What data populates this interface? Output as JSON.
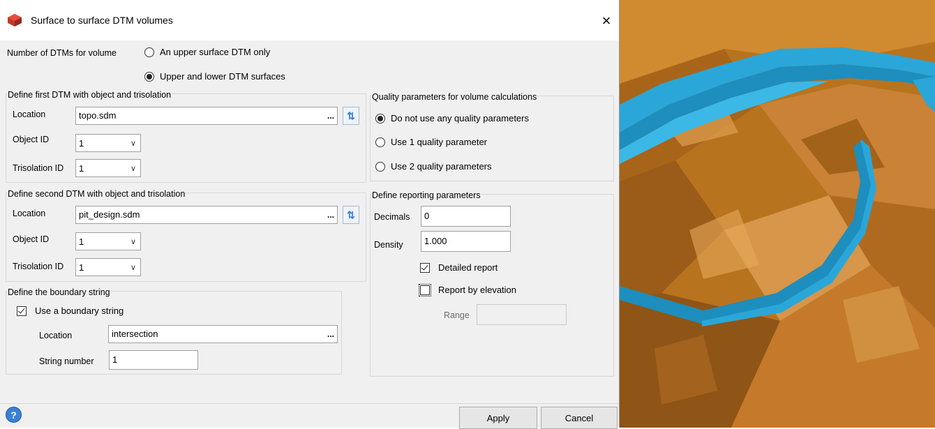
{
  "window": {
    "title": "Surface to surface DTM volumes",
    "close_icon": "×"
  },
  "dtm_count": {
    "label": "Number of DTMs for volume",
    "options": [
      {
        "label": "An upper surface DTM only",
        "selected": false
      },
      {
        "label": "Upper and lower DTM surfaces",
        "selected": true
      }
    ]
  },
  "first_dtm": {
    "legend": "Define first DTM with object and trisolation",
    "location_label": "Location",
    "location_value": "topo.sdm",
    "browse": "...",
    "object_label": "Object ID",
    "object_value": "1",
    "trisolation_label": "Trisolation ID",
    "trisolation_value": "1"
  },
  "second_dtm": {
    "legend": "Define second DTM with object and trisolation",
    "location_label": "Location",
    "location_value": "pit_design.sdm",
    "browse": "...",
    "object_label": "Object ID",
    "object_value": "1",
    "trisolation_label": "Trisolation ID",
    "trisolation_value": "1"
  },
  "boundary": {
    "legend": "Define the boundary string",
    "use_label": "Use a boundary string",
    "use_checked": true,
    "location_label": "Location",
    "location_value": "intersection",
    "browse": "...",
    "string_label": "String number",
    "string_value": "1"
  },
  "quality": {
    "legend": "Quality parameters for volume calculations",
    "options": [
      {
        "label": "Do not use any quality parameters",
        "selected": true
      },
      {
        "label": "Use 1 quality parameter",
        "selected": false
      },
      {
        "label": "Use 2 quality parameters",
        "selected": false
      }
    ]
  },
  "reporting": {
    "legend": "Define reporting parameters",
    "decimals_label": "Decimals",
    "decimals_value": "0",
    "density_label": "Density",
    "density_value": "1.000",
    "detailed_label": "Detailed report",
    "detailed_checked": true,
    "elevation_label": "Report by elevation",
    "elevation_checked": false,
    "range_label": "Range",
    "range_value": ""
  },
  "buttons": {
    "help": "?",
    "apply": "Apply",
    "cancel": "Cancel"
  },
  "icons": {
    "app": "app-icon",
    "refresh": "refresh-icon",
    "chevron": "chevron-down-icon"
  },
  "colors": {
    "terrain": "#c47a1e",
    "pit_wall": "#2aa7d8"
  }
}
